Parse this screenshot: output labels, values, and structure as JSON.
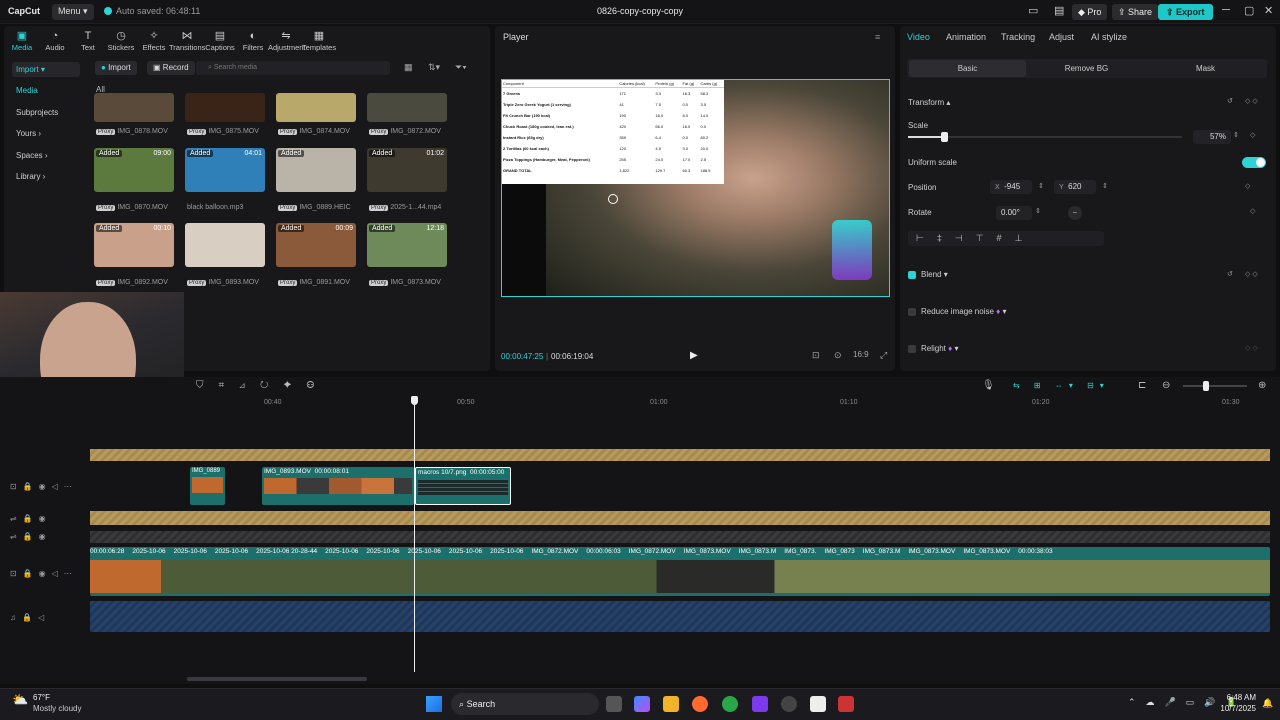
{
  "app": {
    "logo": "CapCut",
    "menu_label": "Menu",
    "autosave": "Auto saved: 06:48:11",
    "project_title": "0826-copy-copy-copy",
    "pro_label": "Pro",
    "share_label": "Share",
    "export_label": "Export"
  },
  "toolbar": [
    {
      "label": "Media",
      "icon": "media-icon"
    },
    {
      "label": "Audio",
      "icon": "audio-icon"
    },
    {
      "label": "Text",
      "icon": "text-icon"
    },
    {
      "label": "Stickers",
      "icon": "sticker-icon"
    },
    {
      "label": "Effects",
      "icon": "effects-icon"
    },
    {
      "label": "Transitions",
      "icon": "transitions-icon"
    },
    {
      "label": "Captions",
      "icon": "captions-icon"
    },
    {
      "label": "Filters",
      "icon": "filters-icon"
    },
    {
      "label": "Adjustment",
      "icon": "adjustment-icon"
    },
    {
      "label": "Templates",
      "icon": "templates-icon"
    }
  ],
  "sidebar": [
    "Import",
    "Media",
    "Subprojects",
    "Yours",
    "Spaces",
    "Library"
  ],
  "media": {
    "import": "Import",
    "record": "Record",
    "search_placeholder": "Search media",
    "filter_all": "All",
    "items": [
      {
        "name": "IMG_0878.MOV",
        "proxy": true,
        "badge": "",
        "dur": ""
      },
      {
        "name": "IMG_0875.MOV",
        "proxy": true,
        "badge": "",
        "dur": ""
      },
      {
        "name": "IMG_0874.MOV",
        "proxy": true,
        "badge": "",
        "dur": ""
      },
      {
        "name": "IMG_0872.MOV",
        "proxy": true,
        "badge": "",
        "dur": ""
      },
      {
        "name": "IMG_0870.MOV",
        "proxy": true,
        "badge": "Added",
        "dur": "09:00"
      },
      {
        "name": "black balloon.mp3",
        "proxy": false,
        "badge": "Added",
        "dur": "04:01"
      },
      {
        "name": "IMG_0889.HEIC",
        "proxy": true,
        "badge": "Added",
        "dur": ""
      },
      {
        "name": "2025-1...44.mp4",
        "proxy": true,
        "badge": "Added",
        "dur": "01:02"
      },
      {
        "name": "IMG_0892.MOV",
        "proxy": true,
        "badge": "Added",
        "dur": "00:10"
      },
      {
        "name": "IMG_0893.MOV",
        "proxy": true,
        "badge": "",
        "dur": ""
      },
      {
        "name": "IMG_0891.MOV",
        "proxy": true,
        "badge": "Added",
        "dur": "00:09"
      },
      {
        "name": "IMG_0873.MOV",
        "proxy": true,
        "badge": "Added",
        "dur": "12:18"
      }
    ]
  },
  "player": {
    "title": "Player",
    "current": "00:00:47:25",
    "total": "00:06:19:04",
    "table": {
      "headers": [
        "Component",
        "Calories (kcal)",
        "Protein (g)",
        "Fat (g)",
        "Carbs (g)"
      ],
      "rows": [
        [
          "7 Greens",
          "171",
          "3.3",
          "16.3",
          "58.3"
        ],
        [
          "Triple Zero Greek Yogurt (1 serving)",
          "41",
          "7.5",
          "0.0",
          "3.5"
        ],
        [
          "Fit Crunch Bar (190 kcal)",
          "190",
          "16.0",
          "8.0",
          "14.0"
        ],
        [
          "Chuck Roast (180g cooked, lean est.)",
          "420",
          "66.0",
          "16.0",
          "0.0"
        ],
        [
          "Instant Rice (65g dry)",
          "359",
          "6.4",
          "0.0",
          "80.2"
        ],
        [
          "2 Tortillas (60 kcal each)",
          "120",
          "4.5",
          "3.0",
          "20.0"
        ],
        [
          "Pizza Toppings (Hamburger, Meat, Pepperoni)",
          "255",
          "24.0",
          "17.0",
          "2.5"
        ],
        [
          "GRAND TOTAL",
          "1,822",
          "129.7",
          "60.3",
          "188.5"
        ]
      ]
    }
  },
  "right": {
    "tabs": [
      "Video",
      "Animation",
      "Tracking",
      "Adjust",
      "AI stylize"
    ],
    "subtabs": [
      "Basic",
      "Remove BG",
      "Mask"
    ],
    "transform": "Transform",
    "scale": "Scale",
    "scale_value": "57%",
    "scale_fraction": 0.57,
    "uniform_scale": "Uniform scale",
    "position": "Position",
    "x_label": "X",
    "x_value": "-945",
    "y_label": "Y",
    "y_value": "620",
    "rotate": "Rotate",
    "rotate_value": "0.00°",
    "blend": "Blend",
    "reduce_noise": "Reduce image noise",
    "relight": "Relight"
  },
  "timeline": {
    "ruler": [
      "00:40",
      "00:50",
      "01:00",
      "01:10",
      "01:20",
      "01:30"
    ],
    "clip_labels": {
      "c1": "IMG_0889",
      "c2": "IMG_0893.MOV",
      "c2d": "00:00:08:01",
      "c3": "macros 10/7.png",
      "c3d": "00:00:05:00"
    },
    "main_labels": [
      "00:00:06:28",
      "2025-10-06",
      "2025-10-06",
      "2025-10-06",
      "2025-10-06 20-28-44",
      "2025-10-06",
      "2025-10-06",
      "2025-10-06",
      "2025-10-06",
      "2025-10-06",
      "IMG_0872.MOV",
      "00:00:06:03",
      "IMG_0872.MOV",
      "IMG_0873.MOV",
      "IMG_0873.M",
      "IMG_0873.",
      "IMG_0873",
      "IMG_0873.M",
      "IMG_0873.MOV",
      "IMG_0873.MOV",
      "00:00:38:03"
    ]
  },
  "taskbar": {
    "weather_temp": "67°F",
    "weather_desc": "Mostly cloudy",
    "search": "Search",
    "time": "6:48 AM",
    "date": "10/7/2025"
  },
  "colors": {
    "accent": "#2fd3d3",
    "clip": "#1c6f6a",
    "gold": "#b89a5b"
  }
}
